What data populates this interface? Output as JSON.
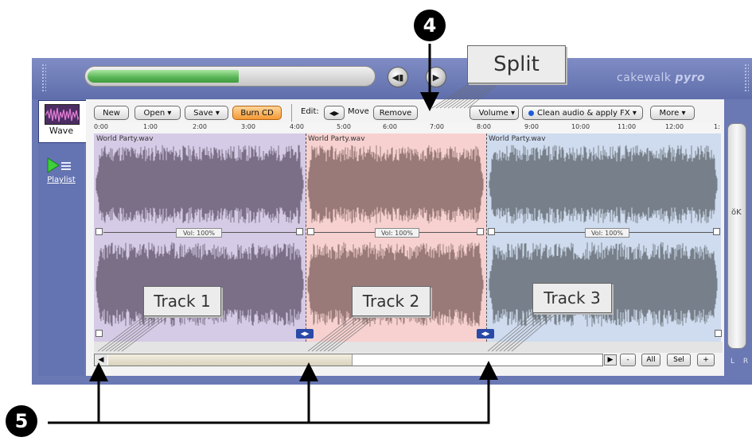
{
  "app": {
    "brand_prefix": "cakewalk",
    "brand_name": "pyro"
  },
  "transport": {
    "progress": 0.53
  },
  "sidebar": {
    "items": [
      {
        "label": "Wave",
        "icon": "waveform-icon"
      },
      {
        "label": "Playlist",
        "icon": "playlist-icon"
      }
    ]
  },
  "toolbar": {
    "new": "New",
    "open": "Open ▾",
    "save": "Save ▾",
    "burn": "Burn CD",
    "edit_label": "Edit:",
    "move_label": "Move",
    "remove": "Remove",
    "volume": "Volume ▾",
    "clean": "Clean audio & apply FX ▾",
    "more": "More ▾"
  },
  "ruler": {
    "ticks": [
      "0:00",
      "1:00",
      "2:00",
      "3:00",
      "4:00",
      "5:00",
      "6:00",
      "7:00",
      "8:00",
      "9:00",
      "10:00",
      "11:00",
      "12:00",
      "1:"
    ]
  },
  "tracks": [
    {
      "filename": "World Party.wav",
      "volume": "Vol: 100%",
      "color": "#d5cbe6",
      "wave_color": "#7a6f86"
    },
    {
      "filename": "World Party.wav",
      "volume": "Vol: 100%",
      "color": "#f6d1d0",
      "wave_color": "#9a7a78"
    },
    {
      "filename": "World Party.wav",
      "volume": "Vol: 100%",
      "color": "#cfdbee",
      "wave_color": "#77808a"
    }
  ],
  "zoom": {
    "minus": "-",
    "all": "All",
    "sel": "Sel",
    "plus": "+"
  },
  "right_panel": {
    "ok": "ŏK",
    "lr": "L R"
  },
  "callouts": {
    "split": "Split",
    "track1": "Track 1",
    "track2": "Track 2",
    "track3": "Track 3",
    "badge4": "4",
    "badge5": "5"
  }
}
